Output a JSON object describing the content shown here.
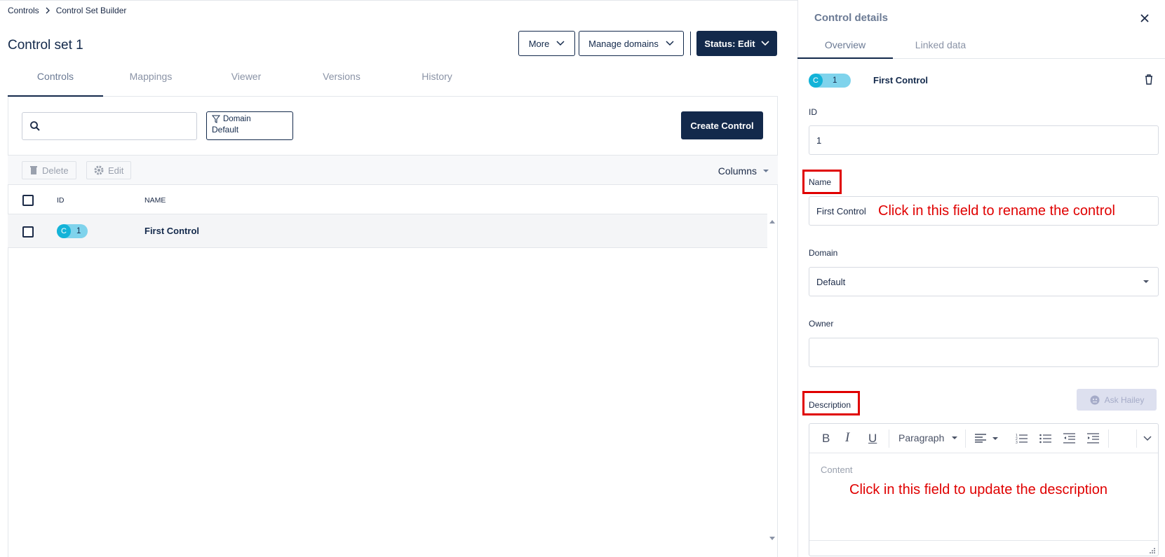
{
  "breadcrumb": {
    "root": "Controls",
    "current": "Control Set Builder"
  },
  "page": {
    "title": "Control set 1"
  },
  "actions": {
    "more": "More",
    "manage_domains": "Manage domains",
    "status": "Status: Edit"
  },
  "tabs": [
    {
      "label": "Controls"
    },
    {
      "label": "Mappings"
    },
    {
      "label": "Viewer"
    },
    {
      "label": "Versions"
    },
    {
      "label": "History"
    }
  ],
  "search": {
    "placeholder": ""
  },
  "filter": {
    "label": "Domain",
    "value": "Default"
  },
  "create_button": "Create Control",
  "toolbar": {
    "delete": "Delete",
    "edit": "Edit",
    "columns": "Columns"
  },
  "table": {
    "headers": {
      "id": "ID",
      "name": "NAME"
    },
    "rows": [
      {
        "badge": "C",
        "id": "1",
        "name": "First Control"
      }
    ]
  },
  "details": {
    "title": "Control details",
    "tabs": [
      {
        "label": "Overview"
      },
      {
        "label": "Linked data"
      }
    ],
    "header": {
      "badge": "C",
      "id": "1",
      "name": "First Control"
    },
    "id_label": "ID",
    "id_value": "1",
    "name_label": "Name",
    "name_value": "First Control",
    "domain_label": "Domain",
    "domain_value": "Default",
    "owner_label": "Owner",
    "owner_value": "",
    "description_label": "Description",
    "ask_button": "Ask Hailey",
    "paragraph_select": "Paragraph",
    "content_placeholder": "Content"
  },
  "annotations": {
    "name_hint": "Click in this field to rename the control",
    "description_hint": "Click in this field to update the description"
  },
  "colors": {
    "primary": "#13294b",
    "badge_dark": "#13b3d8",
    "badge_light": "#7fd3ec",
    "annotation": "#e00000"
  }
}
